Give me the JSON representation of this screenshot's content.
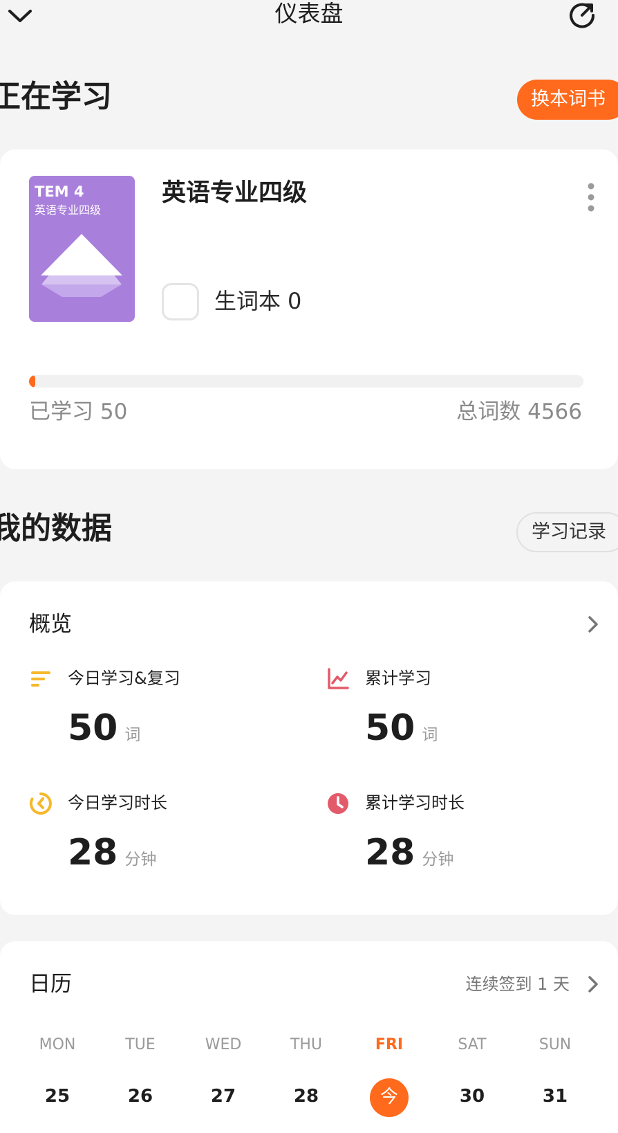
{
  "header": {
    "title": "仪表盘",
    "back_icon": "chevron-down-icon",
    "share_icon": "share-arrow-icon"
  },
  "studying": {
    "section_title": "正在学习",
    "switch_button": "换本词书",
    "book": {
      "cover_code": "TEM 4",
      "cover_name": "英语专业四级",
      "name": "英语专业四级",
      "vocab_label": "生词本",
      "vocab_count": "0",
      "learned_label": "已学习 50",
      "total_label": "总词数 4566",
      "learned": 50,
      "total": 4566,
      "cover_color": "#a97fdc"
    }
  },
  "my_data": {
    "section_title": "我的数据",
    "record_button": "学习记录",
    "overview_title": "概览",
    "stats": [
      {
        "label": "今日学习&复习",
        "value": "50",
        "unit": "词",
        "icon": "list-lines-icon",
        "color": "#f5b82a"
      },
      {
        "label": "累计学习",
        "value": "50",
        "unit": "词",
        "icon": "line-chart-icon",
        "color": "#e35a6a"
      },
      {
        "label": "今日学习时长",
        "value": "28",
        "unit": "分钟",
        "icon": "timer-icon",
        "color": "#f5b82a"
      },
      {
        "label": "累计学习时长",
        "value": "28",
        "unit": "分钟",
        "icon": "clock-icon",
        "color": "#e35a6a"
      }
    ]
  },
  "calendar": {
    "title": "日历",
    "streak": "连续签到 1 天",
    "weekdays": [
      "MON",
      "TUE",
      "WED",
      "THU",
      "FRI",
      "SAT",
      "SUN"
    ],
    "days": [
      "25",
      "26",
      "27",
      "28",
      "今",
      "30",
      "31"
    ],
    "today_index": 4
  },
  "colors": {
    "accent": "#ff6a1c",
    "background": "#f4f4f4",
    "card": "#ffffff"
  }
}
